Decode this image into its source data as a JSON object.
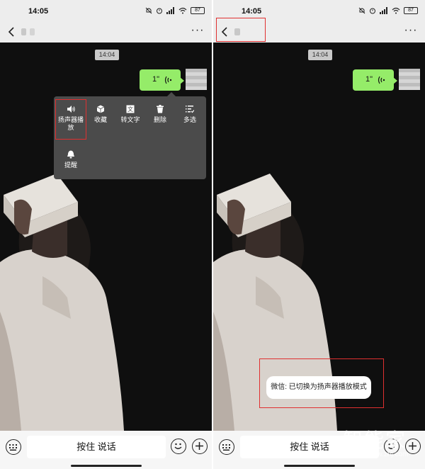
{
  "left": {
    "status_time": "14:05",
    "battery": "87",
    "timestamp": "14:04",
    "voice_duration": "1\"",
    "context_menu": {
      "items": [
        {
          "label": "扬声器播放",
          "icon": "speaker-icon"
        },
        {
          "label": "收藏",
          "icon": "cube-icon"
        },
        {
          "label": "转文字",
          "icon": "text-convert-icon"
        },
        {
          "label": "删除",
          "icon": "trash-icon"
        },
        {
          "label": "多选",
          "icon": "multiselect-icon"
        },
        {
          "label": "提醒",
          "icon": "bell-icon"
        }
      ]
    },
    "bottom": {
      "talk_label": "按住 说话"
    }
  },
  "right": {
    "status_time": "14:05",
    "battery": "87",
    "timestamp": "14:04",
    "voice_duration": "1\"",
    "toast": "微信: 已切换为扬声器播放模式",
    "bottom": {
      "talk_label": "按住 说话"
    }
  },
  "watermark": {
    "logo": "智能家",
    "url": "www.znj.com"
  },
  "colors": {
    "bubble": "#95ec69",
    "header": "#ededed",
    "menu": "#4b4b4b",
    "highlight": "#e03030"
  }
}
